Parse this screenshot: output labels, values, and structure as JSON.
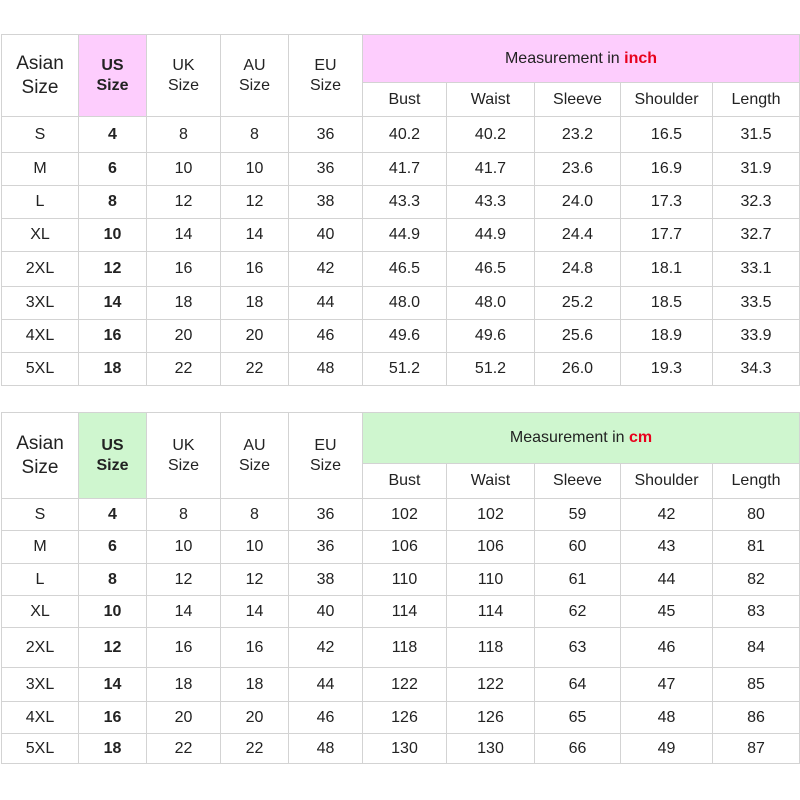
{
  "colors": {
    "inch_accent": "#fdcdfd",
    "cm_accent": "#cff6cf",
    "unit_text": "#e8001c"
  },
  "headers": {
    "asian": "Asian Size",
    "us": "US Size",
    "uk": "UK Size",
    "au": "AU Size",
    "eu": "EU Size",
    "measurement_prefix": "Measurement in",
    "bust": "Bust",
    "waist": "Waist",
    "sleeve": "Sleeve",
    "shoulder": "Shoulder",
    "length": "Length"
  },
  "inch_table": {
    "unit": "inch",
    "rows": [
      [
        "S",
        "4",
        "8",
        "8",
        "36",
        "40.2",
        "40.2",
        "23.2",
        "16.5",
        "31.5"
      ],
      [
        "M",
        "6",
        "10",
        "10",
        "36",
        "41.7",
        "41.7",
        "23.6",
        "16.9",
        "31.9"
      ],
      [
        "L",
        "8",
        "12",
        "12",
        "38",
        "43.3",
        "43.3",
        "24.0",
        "17.3",
        "32.3"
      ],
      [
        "XL",
        "10",
        "14",
        "14",
        "40",
        "44.9",
        "44.9",
        "24.4",
        "17.7",
        "32.7"
      ],
      [
        "2XL",
        "12",
        "16",
        "16",
        "42",
        "46.5",
        "46.5",
        "24.8",
        "18.1",
        "33.1"
      ],
      [
        "3XL",
        "14",
        "18",
        "18",
        "44",
        "48.0",
        "48.0",
        "25.2",
        "18.5",
        "33.5"
      ],
      [
        "4XL",
        "16",
        "20",
        "20",
        "46",
        "49.6",
        "49.6",
        "25.6",
        "18.9",
        "33.9"
      ],
      [
        "5XL",
        "18",
        "22",
        "22",
        "48",
        "51.2",
        "51.2",
        "26.0",
        "19.3",
        "34.3"
      ]
    ]
  },
  "cm_table": {
    "unit": "cm",
    "rows": [
      [
        "S",
        "4",
        "8",
        "8",
        "36",
        "102",
        "102",
        "59",
        "42",
        "80"
      ],
      [
        "M",
        "6",
        "10",
        "10",
        "36",
        "106",
        "106",
        "60",
        "43",
        "81"
      ],
      [
        "L",
        "8",
        "12",
        "12",
        "38",
        "110",
        "110",
        "61",
        "44",
        "82"
      ],
      [
        "XL",
        "10",
        "14",
        "14",
        "40",
        "114",
        "114",
        "62",
        "45",
        "83"
      ],
      [
        "2XL",
        "12",
        "16",
        "16",
        "42",
        "118",
        "118",
        "63",
        "46",
        "84"
      ],
      [
        "3XL",
        "14",
        "18",
        "18",
        "44",
        "122",
        "122",
        "64",
        "47",
        "85"
      ],
      [
        "4XL",
        "16",
        "20",
        "20",
        "46",
        "126",
        "126",
        "65",
        "48",
        "86"
      ],
      [
        "5XL",
        "18",
        "22",
        "22",
        "48",
        "130",
        "130",
        "66",
        "49",
        "87"
      ]
    ]
  }
}
